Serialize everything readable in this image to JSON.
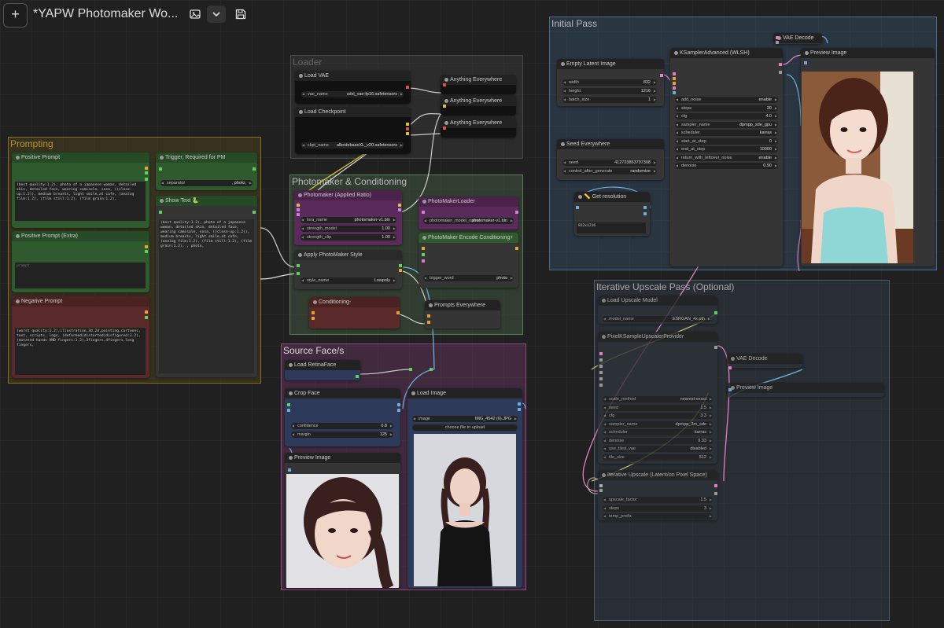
{
  "toolbar": {
    "add_icon": "+",
    "title": "*YAPW Photomaker Wo...",
    "image_icon": "image-icon",
    "chevron_icon": "chevron-down-icon",
    "save_icon": "save-icon"
  },
  "groups": {
    "loader": "Loader",
    "prompting": "Prompting",
    "photomaker": "Photomaker & Conditioning",
    "source": "Source Face/s",
    "initial": "Initial Pass",
    "upscale": "Iterative Upscale Pass (Optional)"
  },
  "colors": {
    "group_prompting": "#8a6e1f",
    "group_photomaker": "#4a6a48",
    "group_source": "#7a3a70",
    "group_initial": "#3a5a78",
    "group_upscale": "#3a4a5c",
    "node_green": "#2e5a2e",
    "node_red": "#5a2a2a",
    "node_purple": "#5a2a5a",
    "node_blue": "#2e3a5a"
  },
  "loader": {
    "load_vae": {
      "title": "Load VAE",
      "vae_name_label": "vae_name",
      "vae_name_value": "sdxl_vae-fp16.safetensors"
    },
    "load_checkpoint": {
      "title": "Load Checkpoint",
      "ckpt_label": "ckpt_name",
      "ckpt_value": "albedobaseXL_v20.safetensors"
    },
    "anything_1": "Anything Everywhere",
    "anything_2": "Anything Everywhere",
    "anything_3": "Anything Everywhere"
  },
  "prompting": {
    "positive": {
      "title": "Positive Prompt",
      "text": "(best quality:1.2), photo of a japanese woman, detailed skin, detailed face, wearing camisole, sosa, ((close-up:1.2)), medium breasts, light smile,at cafe, (analog film:1.2), (film still:1.2), (film grain:1.2),"
    },
    "trigger": {
      "title": "Trigger, Required for PM",
      "separator_label": "separator",
      "separator_value": ", photo,"
    },
    "show_text": {
      "title": "Show Text 🐍",
      "text": "(best quality:1.2), photo of a japanese woman, detailed skin, detailed face, wearing camisole, sosa, ((close-up:1.2)), medium breasts, light smile,at cafe, (analog film:1.2), (film still:1.2), (film grain:1.2), , photo,"
    },
    "positive_extra": {
      "title": "Positive Prompt (Extra)",
      "placeholder": "prompt"
    },
    "negative": {
      "title": "Negative Prompt",
      "text": "(worst quality:1.2),illustration,3d,2d,painting,cartoons, text, scripts, logs, (deformed|distorted|disfigured:1.2),(mutated hands AND fingers:1.2),3fingers,4fingers,long fingers,"
    }
  },
  "photomaker": {
    "applied_ratio": {
      "title": "Photomaker (Applied Ratio)",
      "lora_label": "lora_name",
      "lora_value": "photomaker-v1.bin",
      "strength_model_label": "strength_model",
      "strength_model_value": "1.00",
      "strength_clip_label": "strength_clip",
      "strength_clip_value": "1.00"
    },
    "loader": {
      "title": "PhotoMakerLoader",
      "model_label": "photomaker_model_name",
      "model_value": "photomaker-v1.bin"
    },
    "encode": {
      "title": "PhotoMaker Encode Conditioning+",
      "trigger_label": "trigger_word",
      "trigger_value": "photo"
    },
    "apply_style": {
      "title": "Apply PhotoMaker Style",
      "style_label": "style_name",
      "style_value": "Lowpoly"
    },
    "conditioning_minus": "Conditioning-",
    "prompts_everywhere": "Prompts Everywhere"
  },
  "source": {
    "retina": "Load RetinaFace",
    "crop": {
      "title": "Crop Face",
      "confidence_label": "confidence",
      "confidence_value": "0.8",
      "margin_label": "margin",
      "margin_value": "125"
    },
    "load_image": {
      "title": "Load Image",
      "image_label": "image",
      "image_value": "IMG_4542 (6).JPG",
      "upload_label": "choose file to upload"
    },
    "preview": "Preview Image"
  },
  "initial": {
    "latent": {
      "title": "Empty Latent Image",
      "width_label": "width",
      "width_value": "832",
      "height_label": "height",
      "height_value": "1216",
      "batch_label": "batch_size",
      "batch_value": "1"
    },
    "ksampler": {
      "title": "KSamplerAdvanced (WLSH)",
      "rows": [
        {
          "label": "add_noise",
          "value": "enable"
        },
        {
          "label": "steps",
          "value": "20"
        },
        {
          "label": "cfg",
          "value": "4.0"
        },
        {
          "label": "sampler_name",
          "value": "dpmpp_sde_gpu"
        },
        {
          "label": "scheduler",
          "value": "karras"
        },
        {
          "label": "start_at_step",
          "value": "0"
        },
        {
          "label": "end_at_step",
          "value": "10000"
        },
        {
          "label": "return_with_leftover_noise",
          "value": "enable"
        },
        {
          "label": "denoise",
          "value": "0.90"
        }
      ]
    },
    "seed": {
      "title": "Seed Everywhere",
      "seed_label": "seed",
      "seed_value": "412723853797308",
      "control_label": "control_after_generate",
      "control_value": "randomize"
    },
    "get_res": {
      "title": "📏 Get resolution",
      "value": "832x1216"
    },
    "vae_decode": "VAE Decode",
    "preview": "Preview Image"
  },
  "upscale": {
    "load_model": {
      "title": "Load Upscale Model",
      "model_label": "model_name",
      "model_value": "ESRGAN_4x.pth"
    },
    "provider": {
      "title": "PixelKSampleUpscalerProvider",
      "rows": [
        {
          "label": "scale_method",
          "value": "nearest-exact"
        },
        {
          "label": "seed",
          "value": "1.5"
        },
        {
          "label": "cfg",
          "value": "3.3"
        },
        {
          "label": "sampler_name",
          "value": "dpmpp_3m_sde"
        },
        {
          "label": "scheduler",
          "value": "karras"
        },
        {
          "label": "denoise",
          "value": "0.33"
        },
        {
          "label": "use_tiled_vae",
          "value": "disabled"
        },
        {
          "label": "tile_size",
          "value": "512"
        }
      ]
    },
    "vae_decode": "VAE Decode",
    "preview": "Preview Image",
    "iterative": {
      "title": "Iterative Upscale (Latent/on Pixel Space)",
      "rows": [
        {
          "label": "upscale_factor",
          "value": "1.5"
        },
        {
          "label": "steps",
          "value": "3"
        },
        {
          "label": "temp_prefix",
          "value": ""
        }
      ]
    }
  }
}
